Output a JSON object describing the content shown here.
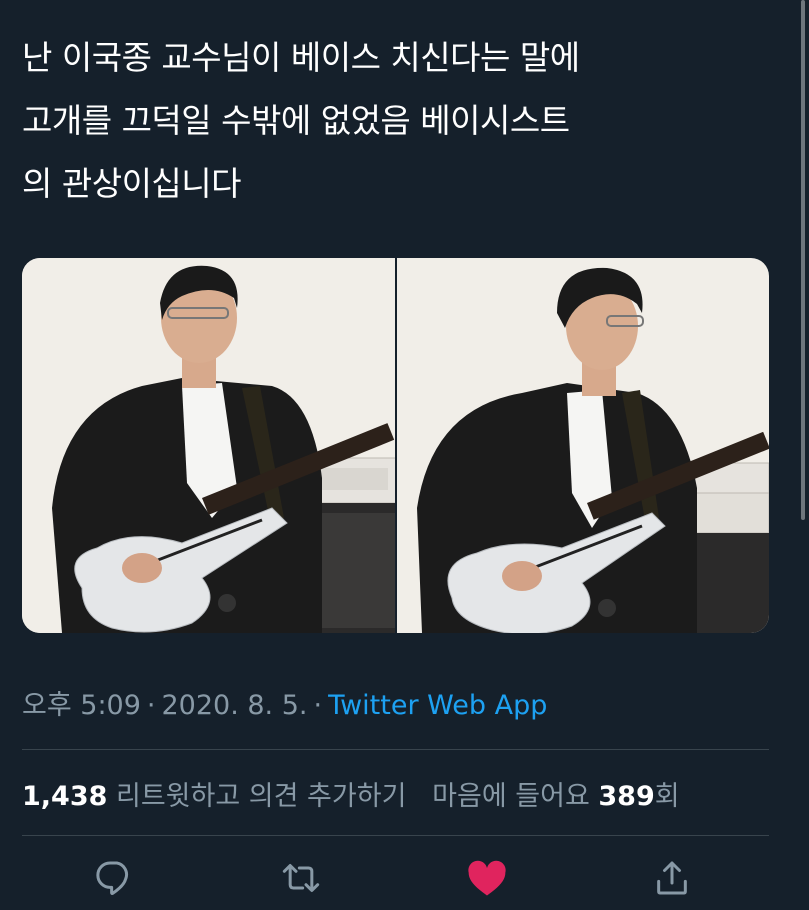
{
  "tweet": {
    "text": "난 이국종 교수님이 베이스 치신다는 말에\n고개를 끄덕일 수밖에 없었음 베이시스트\n의 관상이십니다"
  },
  "meta": {
    "time": "오후 5:09",
    "date": "2020. 8. 5.",
    "separator": "·",
    "source": "Twitter Web App"
  },
  "stats": {
    "retweet_count": "1,438",
    "retweet_label": "리트윗하고 의견 추가하기",
    "like_label": "마음에 들어요",
    "like_count": "389",
    "like_suffix": "회"
  },
  "colors": {
    "background": "#15202b",
    "secondary_text": "#8899a6",
    "link": "#1da1f2",
    "like_active": "#e0245e",
    "divider": "#38444d"
  },
  "actions": [
    "reply-icon",
    "retweet-icon",
    "like-icon",
    "share-icon"
  ]
}
